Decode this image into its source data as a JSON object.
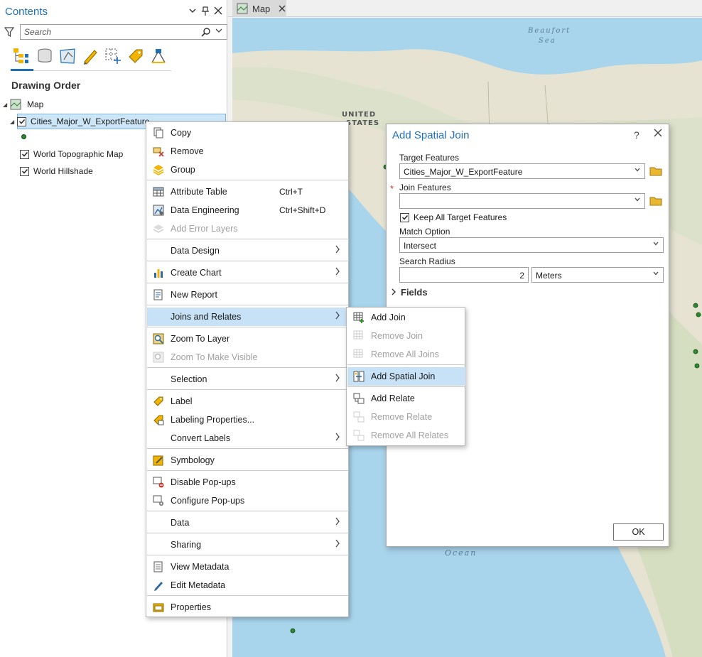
{
  "contents": {
    "title": "Contents",
    "search": {
      "placeholder": "Search"
    },
    "section_title": "Drawing Order",
    "tree": {
      "map": "Map",
      "layer_selected": "Cities_Major_W_ExportFeature",
      "layer2": "World Topographic Map",
      "layer3": "World Hillshade"
    }
  },
  "map_tab": {
    "label": "Map"
  },
  "map_labels": {
    "beaufort": "Beaufort",
    "sea": "Sea",
    "united": "UNITED",
    "states": "STATES",
    "ocean": "Ocean"
  },
  "context_menu": {
    "copy": "Copy",
    "remove": "Remove",
    "group": "Group",
    "attribute_table": "Attribute Table",
    "attribute_table_shortcut": "Ctrl+T",
    "data_engineering": "Data Engineering",
    "data_engineering_shortcut": "Ctrl+Shift+D",
    "add_error_layers": "Add Error Layers",
    "data_design": "Data Design",
    "create_chart": "Create Chart",
    "new_report": "New Report",
    "joins_and_relates": "Joins and Relates",
    "zoom_to_layer": "Zoom To Layer",
    "zoom_to_make_visible": "Zoom To Make Visible",
    "selection": "Selection",
    "label": "Label",
    "labeling_properties": "Labeling Properties...",
    "convert_labels": "Convert Labels",
    "symbology": "Symbology",
    "disable_popups": "Disable Pop-ups",
    "configure_popups": "Configure Pop-ups",
    "data": "Data",
    "sharing": "Sharing",
    "view_metadata": "View Metadata",
    "edit_metadata": "Edit Metadata",
    "properties": "Properties"
  },
  "submenu": {
    "add_join": "Add Join",
    "remove_join": "Remove Join",
    "remove_all_joins": "Remove All Joins",
    "add_spatial_join": "Add Spatial Join",
    "add_relate": "Add Relate",
    "remove_relate": "Remove Relate",
    "remove_all_relates": "Remove All Relates"
  },
  "dialog": {
    "title": "Add Spatial Join",
    "help": "?",
    "target_label": "Target Features",
    "target_value": "Cities_Major_W_ExportFeature",
    "join_label": "Join Features",
    "join_value": "",
    "required_mark": "*",
    "keep_all_label": "Keep All Target Features",
    "keep_all_checked": true,
    "match_label": "Match Option",
    "match_value": "Intersect",
    "radius_label": "Search Radius",
    "radius_value": "2",
    "radius_unit": "Meters",
    "fields_label": "Fields",
    "ok_label": "OK"
  },
  "colors": {
    "accent": "#1f6fb5",
    "highlight": "#c7e2f6",
    "ocean": "#a8d4ec",
    "land": "#e6e3d3",
    "disabled_text": "#a0a0a0"
  }
}
